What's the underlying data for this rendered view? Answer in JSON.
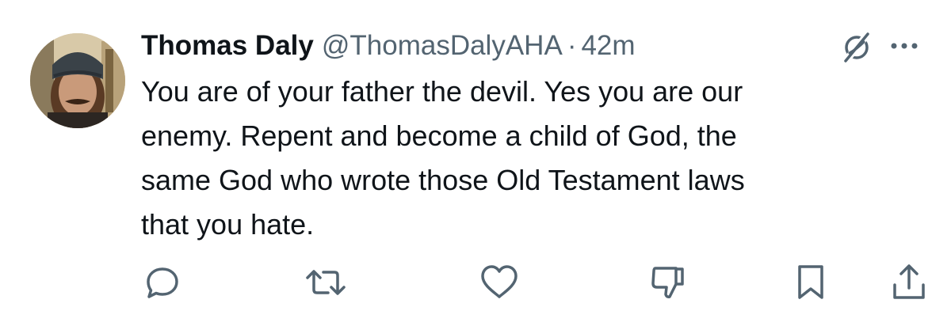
{
  "tweet": {
    "author": {
      "display_name": "Thomas Daly",
      "handle": "@ThomasDalyAHA"
    },
    "separator": "·",
    "time": "42m",
    "text": "You are of your father the devil. Yes you are our\nenemy. Repent and become a child of God, the\nsame God who wrote those Old Testament laws\nthat you hate."
  },
  "icons": {
    "header": [
      "grok-icon",
      "more-icon"
    ],
    "actions": [
      "reply-icon",
      "retweet-icon",
      "like-icon",
      "dislike-icon",
      "bookmark-icon",
      "share-icon"
    ]
  },
  "colors": {
    "text": "#0f1419",
    "secondary": "#536471"
  }
}
